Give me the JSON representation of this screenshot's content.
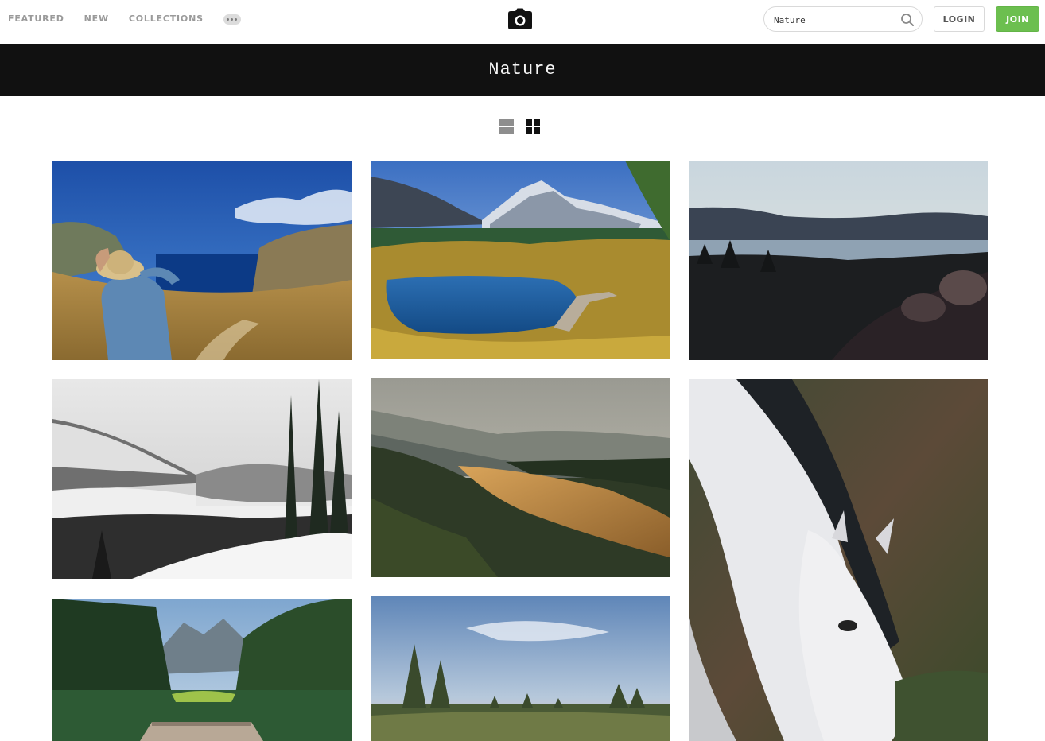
{
  "nav": {
    "links": [
      "FEATURED",
      "NEW",
      "COLLECTIONS"
    ],
    "more_icon": "ellipsis-icon"
  },
  "logo": {
    "icon": "camera-icon"
  },
  "search": {
    "value": "Nature",
    "icon": "search-icon"
  },
  "auth": {
    "login_label": "LOGIN",
    "join_label": "JOIN"
  },
  "page": {
    "title": "Nature"
  },
  "view_toggle": {
    "list_icon": "list-view-icon",
    "grid_icon": "grid-view-icon",
    "active": "grid"
  },
  "gallery": {
    "photos": [
      "woman-in-hat-overlooking-sea-bay",
      "mountain-lake-with-boardwalk",
      "lake-and-hills-at-dusk",
      "snowy-mountains-and-fog",
      "golden-hills-at-sunrise",
      "white-horse-grazing",
      "green-lake-with-wooden-pier",
      "marsh-with-pine-trees"
    ]
  },
  "colors": {
    "accent_green": "#6cbf4f",
    "title_band": "#111111",
    "nav_text": "#9a9a9a"
  }
}
